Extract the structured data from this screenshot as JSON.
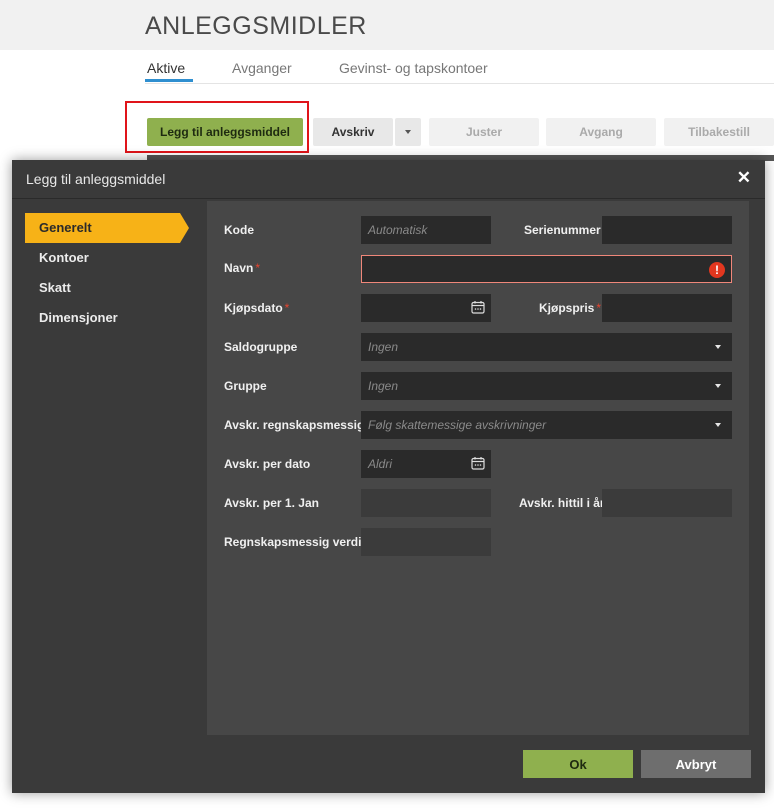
{
  "page": {
    "title": "ANLEGGSMIDLER",
    "tabs": [
      {
        "label": "Aktive",
        "active": true
      },
      {
        "label": "Avganger",
        "active": false
      },
      {
        "label": "Gevinst- og tapskontoer",
        "active": false
      }
    ],
    "toolbar": {
      "add": "Legg til anleggsmiddel",
      "depreciate": "Avskriv",
      "adjust": "Juster",
      "disposal": "Avgang",
      "reset": "Tilbakestill"
    }
  },
  "modal": {
    "title": "Legg til anleggsmiddel",
    "close_icon": "close-icon",
    "nav": [
      {
        "label": "Generelt",
        "active": true
      },
      {
        "label": "Kontoer",
        "active": false
      },
      {
        "label": "Skatt",
        "active": false
      },
      {
        "label": "Dimensjoner",
        "active": false
      }
    ],
    "form": {
      "kode": {
        "label": "Kode",
        "placeholder": "Automatisk",
        "value": ""
      },
      "serienummer": {
        "label": "Serienummer",
        "value": ""
      },
      "navn": {
        "label": "Navn",
        "required": "*",
        "value": "",
        "error_icon": "error-icon"
      },
      "kjopsdato": {
        "label": "Kjøpsdato",
        "required": "*",
        "value": "",
        "icon": "calendar-icon"
      },
      "kjopspris": {
        "label": "Kjøpspris",
        "required": "*",
        "value": ""
      },
      "saldogruppe": {
        "label": "Saldogruppe",
        "placeholder": "Ingen"
      },
      "gruppe": {
        "label": "Gruppe",
        "placeholder": "Ingen"
      },
      "avskr_regnskapsmessig": {
        "label": "Avskr. regnskapsmessig",
        "placeholder": "Følg skattemessige avskrivninger"
      },
      "avskr_per_dato": {
        "label": "Avskr. per dato",
        "placeholder": "Aldri",
        "icon": "calendar-icon"
      },
      "avskr_per_1_jan": {
        "label": "Avskr. per 1. Jan",
        "value": ""
      },
      "avskr_hittil": {
        "label": "Avskr. hittil i år",
        "value": ""
      },
      "regnskapsmessig_verdi": {
        "label": "Regnskapsmessig verdi",
        "value": ""
      }
    },
    "footer": {
      "ok": "Ok",
      "cancel": "Avbryt"
    }
  },
  "colors": {
    "accent_yellow": "#f7b217",
    "primary_green": "#8fb04e",
    "highlight_red": "#e0141a",
    "error_red": "#e2371f"
  }
}
